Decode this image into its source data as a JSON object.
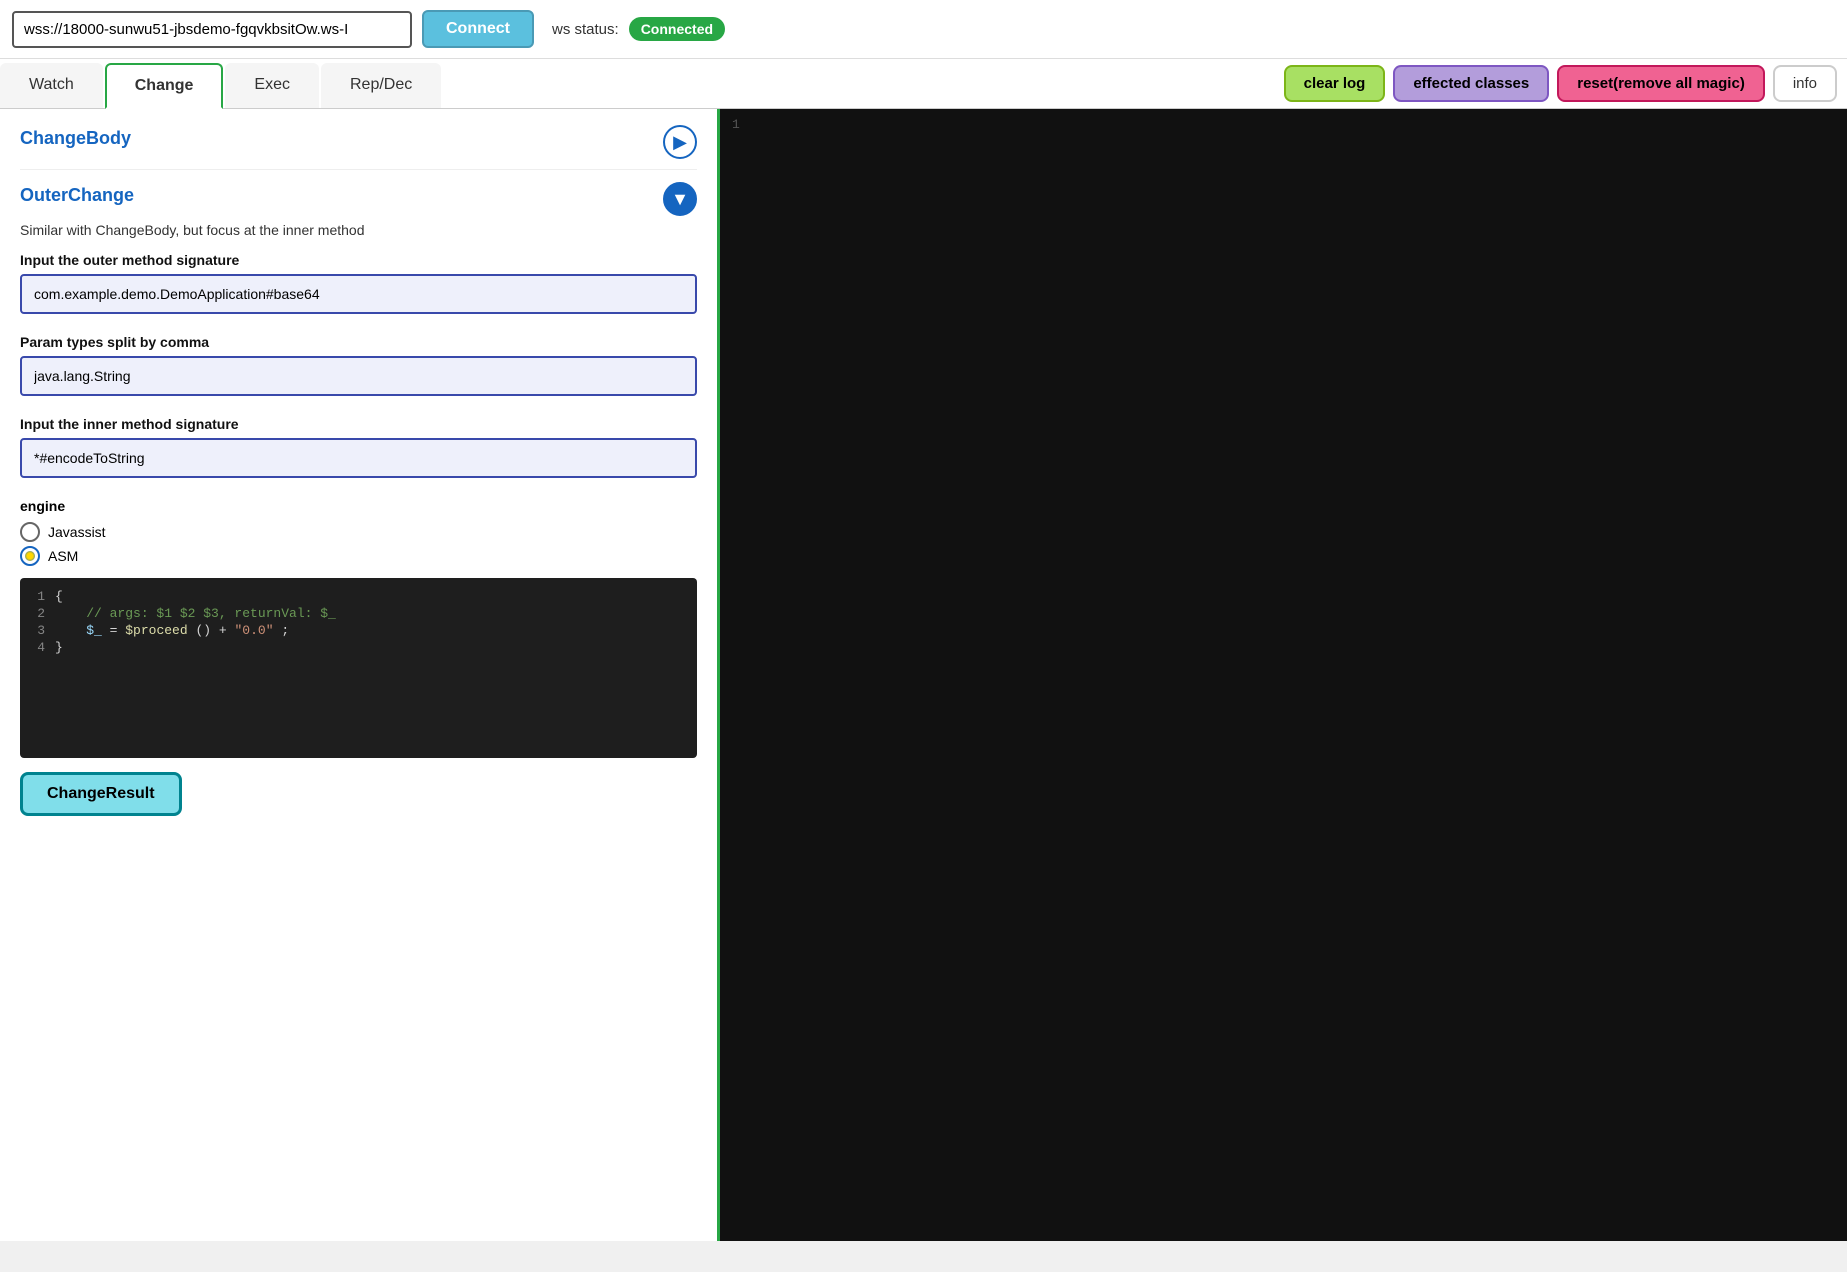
{
  "header": {
    "ws_url": "wss://18000-sunwu51-jbsdemo-fgqvkbsitOw.ws-I",
    "connect_label": "Connect",
    "ws_status_label": "ws status:",
    "status_badge": "Connected"
  },
  "tabs": {
    "items": [
      {
        "id": "watch",
        "label": "Watch",
        "active": false
      },
      {
        "id": "change",
        "label": "Change",
        "active": true
      },
      {
        "id": "exec",
        "label": "Exec",
        "active": false
      },
      {
        "id": "repdec",
        "label": "Rep/Dec",
        "active": false
      }
    ],
    "buttons": {
      "clear_log": "clear log",
      "effected_classes": "effected classes",
      "reset": "reset(remove all magic)",
      "info": "info"
    }
  },
  "left_panel": {
    "change_body": {
      "title": "ChangeBody"
    },
    "outer_change": {
      "title": "OuterChange",
      "description": "Similar with ChangeBody, but focus at the inner method",
      "outer_method_label": "Input the outer method signature",
      "outer_method_value": "com.example.demo.DemoApplication#base64",
      "param_types_label": "Param types split by comma",
      "param_types_value": "java.lang.String",
      "inner_method_label": "Input the inner method signature",
      "inner_method_value": "*#encodeToString",
      "engine_label": "engine",
      "engine_options": [
        {
          "id": "javassist",
          "label": "Javassist",
          "selected": false
        },
        {
          "id": "asm",
          "label": "ASM",
          "selected": true
        }
      ],
      "code_lines": [
        {
          "num": "1",
          "content": "{",
          "type": "brace"
        },
        {
          "num": "2",
          "content": "    // args: $1 $2 $3, returnVal: $_",
          "type": "comment"
        },
        {
          "num": "3",
          "content": "    $_ = $proceed() + \"0.0\";",
          "type": "code"
        },
        {
          "num": "4",
          "content": "}",
          "type": "brace"
        }
      ]
    },
    "change_result_btn": "ChangeResult"
  },
  "right_panel": {
    "log_line": "1"
  }
}
